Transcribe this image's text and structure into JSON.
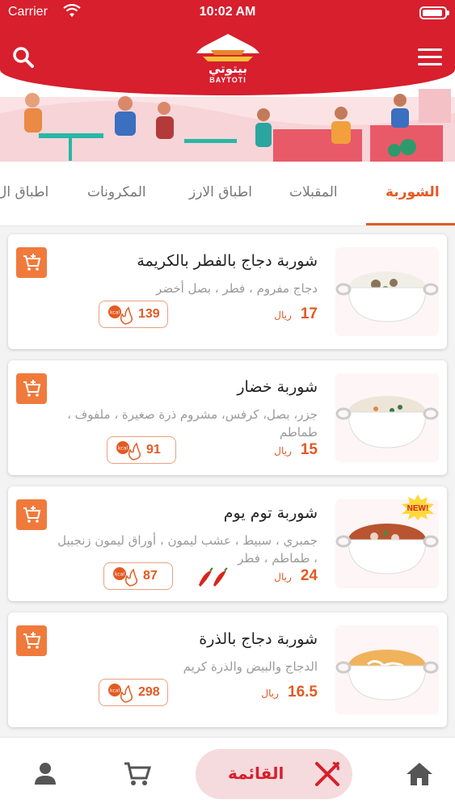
{
  "status_bar": {
    "carrier": "Carrier",
    "time": "10:02 AM"
  },
  "header": {
    "logo_arabic": "بيتوتي",
    "logo_english": "BAYTOTI",
    "brand_color": "#d71f2d",
    "accent_color": "#e35a22"
  },
  "tabs": [
    {
      "label": "الشوربة",
      "active": true
    },
    {
      "label": "المقبلات",
      "active": false
    },
    {
      "label": "اطباق الارز",
      "active": false
    },
    {
      "label": "المكرونات",
      "active": false
    },
    {
      "label": "اطباق ال",
      "active": false
    }
  ],
  "items": [
    {
      "name": "شوربة دجاج بالفطر بالكريمة",
      "description": "دجاج مفروم ، فطر ، بصل أخضر",
      "price": "17",
      "currency": "ريال",
      "kcal": "139",
      "spicy": false,
      "is_new": false
    },
    {
      "name": "شوربة خضار",
      "description": "جزر، بصل، كرفس، مشروم ذرة صغيرة ، ملفوف ، طماطم",
      "price": "15",
      "currency": "ريال",
      "kcal": "91",
      "spicy": false,
      "is_new": false
    },
    {
      "name": "شوربة توم يوم",
      "description": "جمبري ، سبيط ، عشب ليمون ، أوراق ليمون زنجبيل ، طماطم ، فطر",
      "price": "24",
      "currency": "ريال",
      "kcal": "87",
      "spicy": true,
      "is_new": true,
      "new_label": "NEW!"
    },
    {
      "name": "شوربة دجاج بالذرة",
      "description": "الدجاج والبيض والذرة كريم",
      "price": "16.5",
      "currency": "ريال",
      "kcal": "298",
      "spicy": false,
      "is_new": false
    }
  ],
  "kcal_badge_label": "kcal",
  "bottom_nav": {
    "menu_label": "القائمة",
    "items": [
      "home-icon",
      "fork-knife-icon",
      "cart-icon",
      "profile-icon"
    ]
  }
}
